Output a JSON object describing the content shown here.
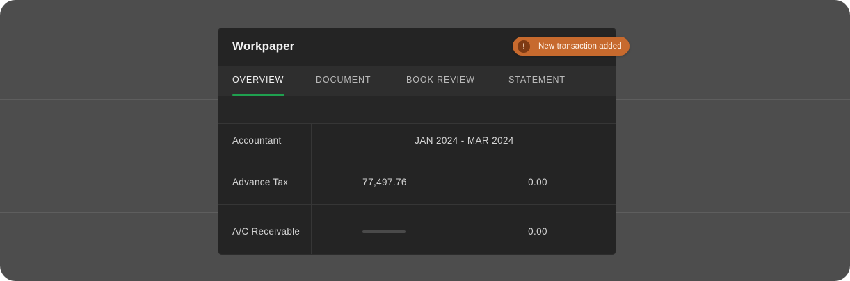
{
  "card": {
    "title": "Workpaper"
  },
  "toast": {
    "icon": "!",
    "icon_name": "exclamation-icon",
    "text": "New transaction added",
    "color": "#c76a2e"
  },
  "tabs": [
    {
      "label": "OVERVIEW",
      "active": true
    },
    {
      "label": "DOCUMENT",
      "active": false
    },
    {
      "label": "BOOK REVIEW",
      "active": false
    },
    {
      "label": "STATEMENT",
      "active": false
    }
  ],
  "accent_color": "#1fa04f",
  "table": {
    "rows": [
      {
        "label": "Accountant",
        "period": "JAN 2024 - MAR 2024"
      },
      {
        "label": "Advance Tax",
        "col1": "77,497.76",
        "col2": "0.00"
      },
      {
        "label": "A/C Receivable",
        "col1": "",
        "col2": "0.00"
      }
    ]
  }
}
